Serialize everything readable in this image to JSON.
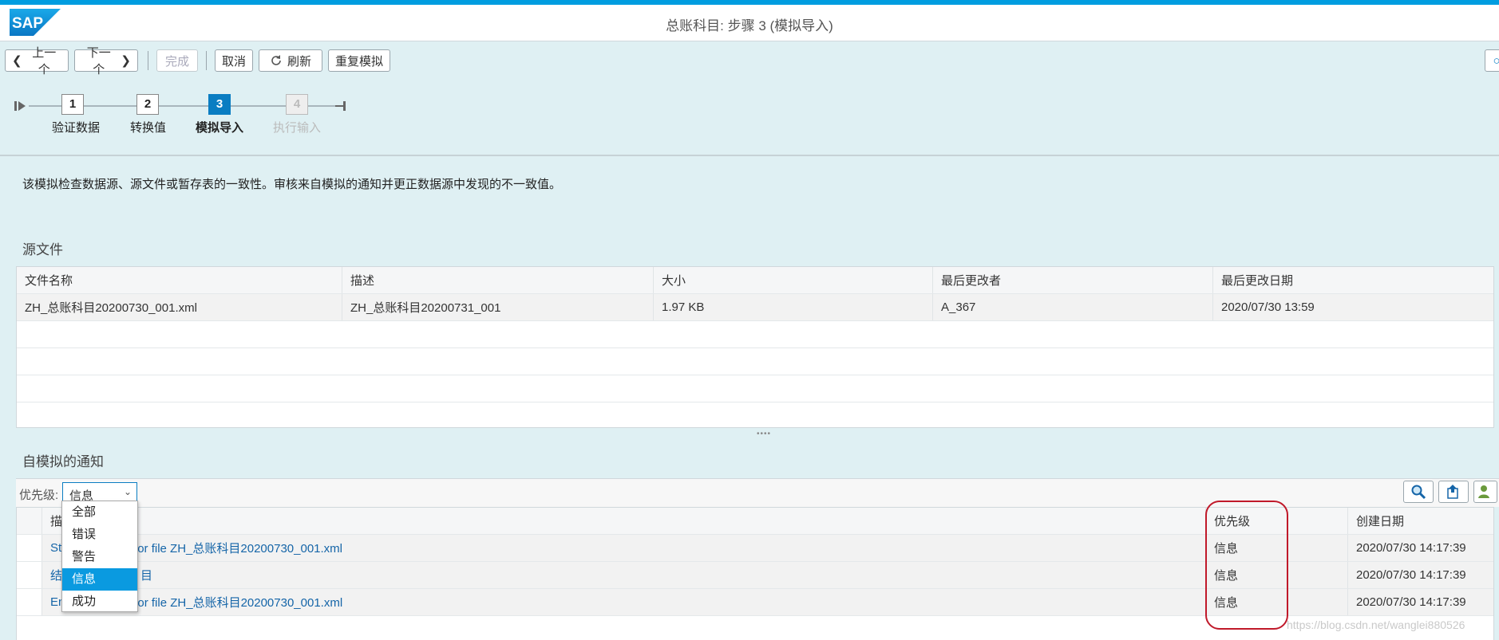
{
  "shell": {
    "logo_text": "SAP",
    "title": "总账科目: 步骤 3 (模拟导入)"
  },
  "toolbar": {
    "prev": "上一个",
    "next": "下一个",
    "finish": "完成",
    "cancel": "取消",
    "refresh": "刷新",
    "resimulate": "重复模拟"
  },
  "wizard": {
    "steps": [
      {
        "num": "1",
        "label": "验证数据",
        "state": "done"
      },
      {
        "num": "2",
        "label": "转换值",
        "state": "done"
      },
      {
        "num": "3",
        "label": "模拟导入",
        "state": "active"
      },
      {
        "num": "4",
        "label": "执行输入",
        "state": "inactive"
      }
    ]
  },
  "description": "该模拟检查数据源、源文件或暂存表的一致性。审核来自模拟的通知并更正数据源中发现的不一致值。",
  "source_files": {
    "title": "源文件",
    "columns": [
      "文件名称",
      "描述",
      "大小",
      "最后更改者",
      "最后更改日期"
    ],
    "rows": [
      [
        "ZH_总账科目20200730_001.xml",
        "ZH_总账科目20200731_001",
        "1.97 KB",
        "A_367",
        "2020/07/30 13:59"
      ]
    ]
  },
  "notifications": {
    "title": "自模拟的通知",
    "priority_label": "优先级:",
    "priority_value": "信息",
    "priority_options": [
      "全部",
      "错误",
      "警告",
      "信息",
      "成功"
    ],
    "columns": [
      "描",
      "优先级",
      "创建日期"
    ],
    "rows": [
      {
        "desc_visible": "St",
        "desc_tail": "ng for file ZH_总账科目20200730_001.xml",
        "priority": "信息",
        "date": "2020/07/30 14:17:39"
      },
      {
        "desc_visible": "结",
        "desc_tail": "目",
        "priority": "信息",
        "date": "2020/07/30 14:17:39"
      },
      {
        "desc_visible": "En",
        "desc_tail": "ng for file ZH_总账科目20200730_001.xml",
        "priority": "信息",
        "date": "2020/07/30 14:17:39"
      }
    ]
  },
  "watermark": "https://blog.csdn.net/wanglei880526"
}
